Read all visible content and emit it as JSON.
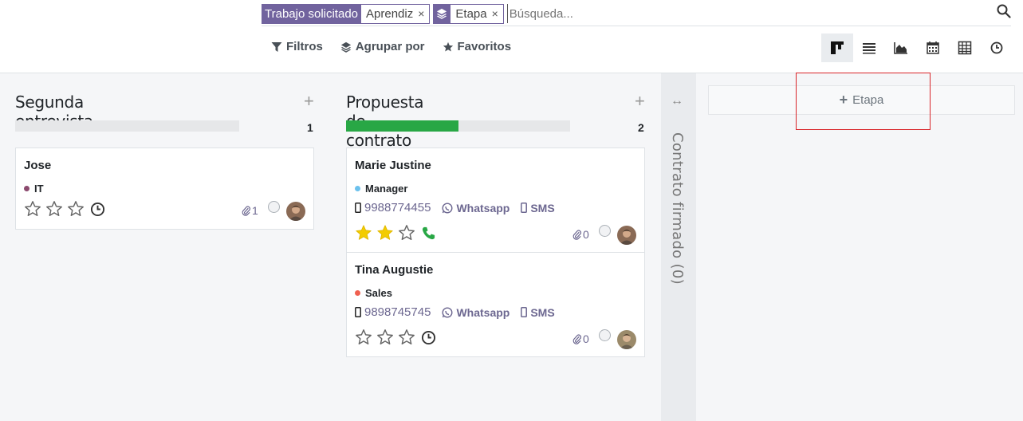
{
  "search": {
    "facets": [
      {
        "category": "Trabajo solicitado",
        "value": "Aprendiz"
      },
      {
        "icon": "layers-icon",
        "value": "Etapa"
      }
    ],
    "remove_glyph": "×",
    "placeholder": "Búsqueda..."
  },
  "toolbar": {
    "filters_label": "Filtros",
    "groupby_label": "Agrupar por",
    "favorites_label": "Favoritos"
  },
  "views": [
    "kanban",
    "list",
    "graph",
    "calendar",
    "pivot",
    "activity"
  ],
  "columns": [
    {
      "title": "Segunda entrevista",
      "count": "1",
      "progress": 0,
      "cards": [
        {
          "name": "Jose",
          "tag": "IT",
          "tag_color": "#8c4a6e",
          "stars": 0,
          "activity": "clock-icon",
          "attachments": "1"
        }
      ]
    },
    {
      "title": "Propuesta de contrato",
      "count": "2",
      "progress": 0.5,
      "cards": [
        {
          "name": "Marie Justine",
          "tag": "Manager",
          "tag_color": "#6cc1ed",
          "phone": "9988774455",
          "whatsapp": "Whatsapp",
          "sms": "SMS",
          "stars": 2,
          "activity": "phone-icon",
          "attachments": "0"
        },
        {
          "name": "Tina Augustie",
          "tag": "Sales",
          "tag_color": "#f06050",
          "phone": "9898745745",
          "whatsapp": "Whatsapp",
          "sms": "SMS",
          "stars": 0,
          "activity": "clock-icon",
          "attachments": "0"
        }
      ]
    }
  ],
  "folded_column": {
    "title": "Contrato firmado (0)"
  },
  "add_stage": {
    "plus": "+",
    "label": "Etapa"
  },
  "colors": {
    "accent": "#71639e",
    "progress": "#28a745",
    "star_filled": "#f3cc00",
    "highlight": "#d9252a"
  }
}
